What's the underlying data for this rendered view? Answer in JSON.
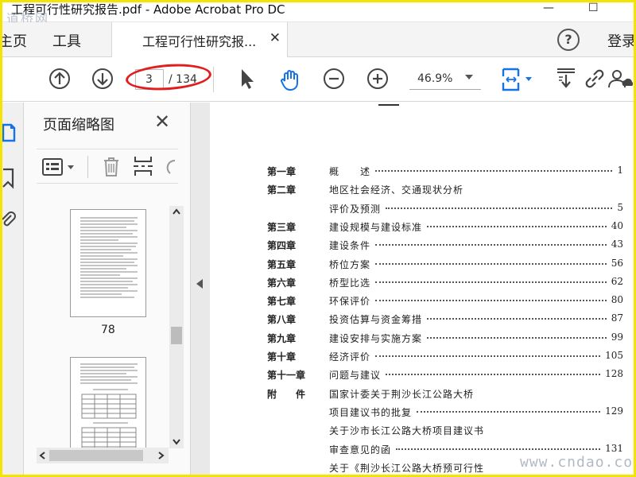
{
  "window": {
    "title": "工程可行性研究报告.pdf - Adobe Acrobat Pro DC",
    "watermark_top": "道桥网",
    "minimize": "—",
    "maximize": "☐"
  },
  "tabs": {
    "home": "主页",
    "tools": "工具",
    "document": "工程可行性研究报...",
    "close": "✕",
    "help": "?",
    "login": "登录"
  },
  "toolbar": {
    "page_current": "3",
    "page_total": "/ 134",
    "zoom": "46.9%"
  },
  "panel": {
    "title": "页面缩略图",
    "close": "✕",
    "thumb_label": "78"
  },
  "toc": [
    {
      "chapter": "第一章",
      "title": "概　　述",
      "page": "1"
    },
    {
      "chapter": "第二章",
      "title": "地区社会经济、交通现状分析",
      "page": ""
    },
    {
      "chapter": "",
      "title": "评价及预测",
      "page": "5"
    },
    {
      "chapter": "第三章",
      "title": "建设规模与建设标准",
      "page": "40"
    },
    {
      "chapter": "第四章",
      "title": "建设条件",
      "page": "43"
    },
    {
      "chapter": "第五章",
      "title": "桥位方案",
      "page": "56"
    },
    {
      "chapter": "第六章",
      "title": "桥型比选",
      "page": "62"
    },
    {
      "chapter": "第七章",
      "title": "环保评价",
      "page": "80"
    },
    {
      "chapter": "第八章",
      "title": "投资估算与资金筹措",
      "page": "87"
    },
    {
      "chapter": "第九章",
      "title": "建设安排与实施方案",
      "page": "99"
    },
    {
      "chapter": "第十章",
      "title": "经济评价",
      "page": "105"
    },
    {
      "chapter": "第十一章",
      "title": "问题与建议",
      "page": "128"
    },
    {
      "chapter": "附　　件",
      "title": "国家计委关于荆沙长江公路大桥",
      "page": ""
    },
    {
      "chapter": "",
      "title": "项目建议书的批复",
      "page": "129"
    },
    {
      "chapter": "",
      "title": "关于沙市长江公路大桥项目建议书",
      "page": ""
    },
    {
      "chapter": "",
      "title": "审查意见的函",
      "page": "131"
    },
    {
      "chapter": "",
      "title": "关于《荆沙长江公路大桥预可行性",
      "page": ""
    }
  ],
  "site_watermark": "www.cndao.com",
  "colors": {
    "frame": "#f5e400",
    "annotation": "#e21d1d",
    "accent": "#1473e6"
  }
}
